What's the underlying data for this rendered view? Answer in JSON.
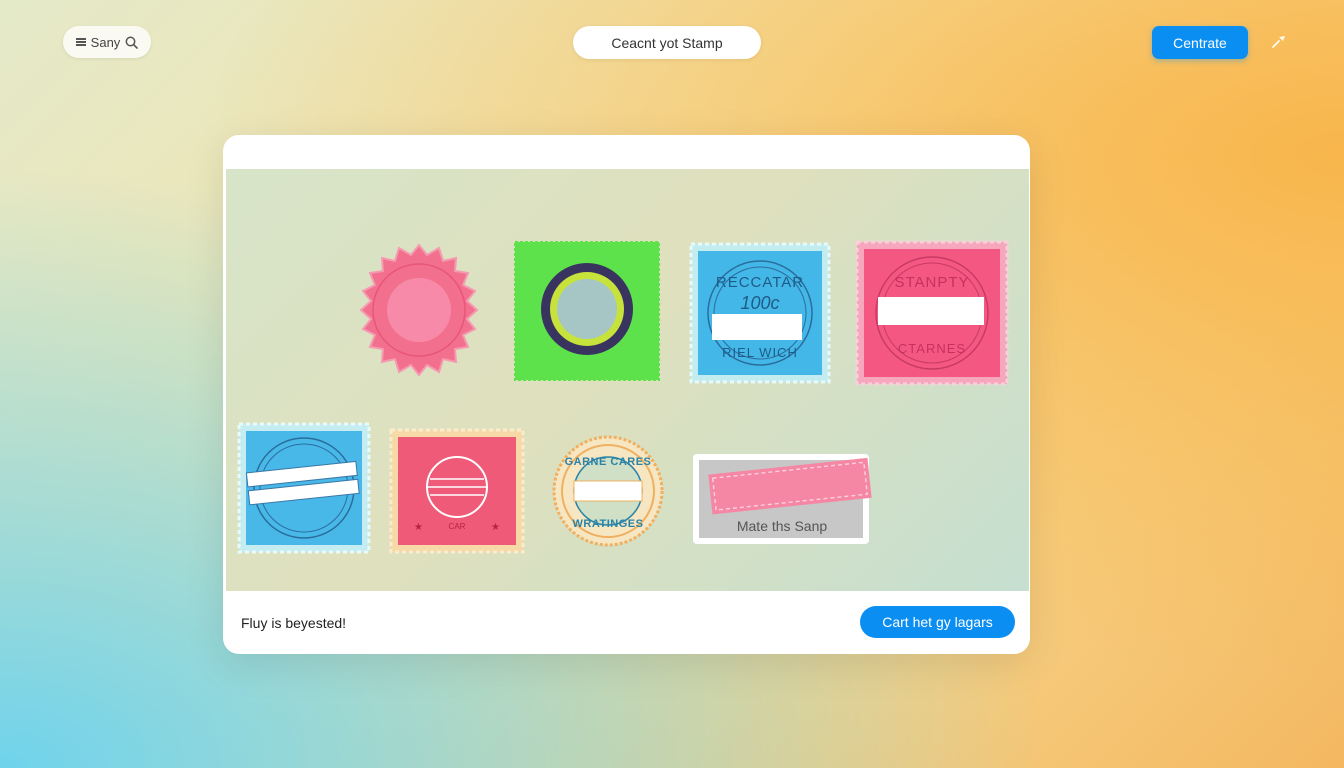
{
  "topbar": {
    "search_label": "Sany",
    "title": "Ceacnt yot Stamp",
    "primary_button": "Centrate"
  },
  "canvas_card": {
    "status_text": "Fluy is beyested!",
    "action_button": "Cart het gy lagars"
  },
  "stamps": [
    {
      "name": "pink-scalloped-round",
      "colors": {
        "base": "#f2708e",
        "inner": "#f78aa8"
      }
    },
    {
      "name": "green-square-ring",
      "colors": {
        "base": "#5de24c",
        "ring": "#39345f",
        "accent": "#c7e23b",
        "center": "#a6c6c6"
      }
    },
    {
      "name": "blue-circle-text",
      "top_text": "RECCATAR",
      "mid_text": "100c",
      "bottom_text": "RIEL WICH",
      "colors": {
        "base": "#43b7e8",
        "border": "#c2ecef"
      }
    },
    {
      "name": "pink-square-text",
      "top_text": "STANPTY",
      "bottom_text": "CTARNES",
      "colors": {
        "base": "#f45882",
        "border": "#f6a6bd"
      }
    },
    {
      "name": "blue-circle-banner",
      "colors": {
        "base": "#48b8e8",
        "border": "#c5ecf0"
      }
    },
    {
      "name": "red-square-circle",
      "small_text": "CAR",
      "colors": {
        "base": "#ef5a78",
        "border": "#f6d9a6"
      }
    },
    {
      "name": "seal-round-text",
      "top_text": "GARNE CARES",
      "bottom_text": "WRATINGES",
      "colors": {
        "ring": "#f0b060",
        "text": "#2a83a6"
      }
    },
    {
      "name": "label-rect",
      "caption": "Mate ths Sanp",
      "colors": {
        "frame": "#c7c7c7",
        "tag": "#f587a4"
      }
    }
  ]
}
